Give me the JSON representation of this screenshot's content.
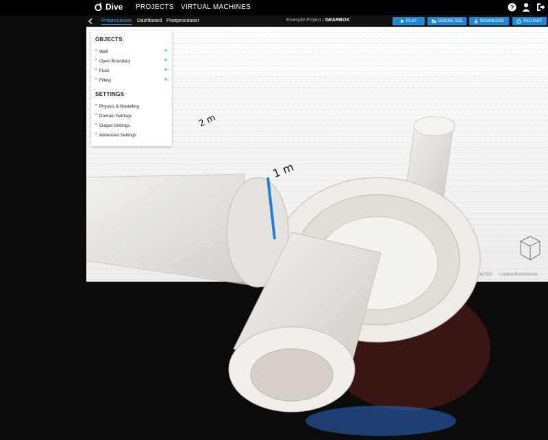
{
  "app": {
    "name": "Dive"
  },
  "nav": {
    "projects": "PROJECTS",
    "vms": "VIRTUAL MACHINES"
  },
  "tabs": {
    "preprocessor": "Preprocessor",
    "dashboard": "Dashboard",
    "postprocessor": "Postprocessor"
  },
  "project": {
    "prefix": "Example Project |",
    "name": "GEARBOX"
  },
  "actions": {
    "play": "PLAY",
    "discretize": "DISCRETIZE",
    "download": "DOWNLOAD",
    "restart": "RESTART"
  },
  "objects": {
    "title": "OBJECTS",
    "items": [
      "Wall",
      "Open Boundary",
      "Fluid",
      "Filling"
    ]
  },
  "settings": {
    "title": "SETTINGS",
    "items": [
      "Physics & Modelling",
      "Domain Settings",
      "Output Settings",
      "Advanced Settings"
    ]
  },
  "viewport": {
    "axis_labels": [
      "2 m",
      "1 m"
    ],
    "status_particles": "42182",
    "status_pointclouds": "Loaded Pointclouds"
  },
  "colors": {
    "accent": "#1a8ad8",
    "topbar": "#000000",
    "grid": "#e6e6e6"
  },
  "icons": [
    "help-icon",
    "user-icon",
    "logout-icon",
    "back-icon",
    "play-icon",
    "discretize-icon",
    "download-icon",
    "restart-icon"
  ]
}
